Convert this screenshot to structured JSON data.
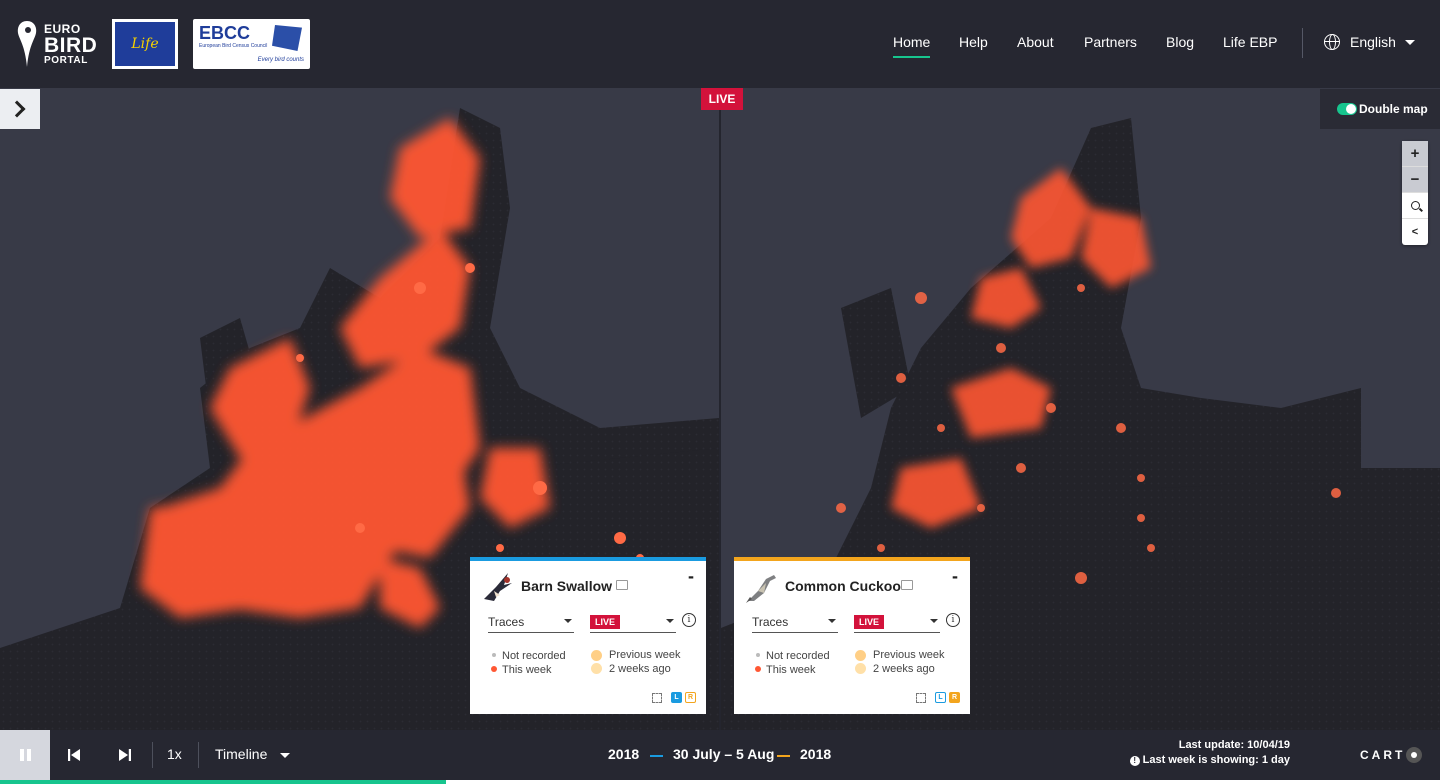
{
  "header": {
    "logo": {
      "line1": "EURO",
      "line2": "BIRD",
      "line3": "PORTAL"
    },
    "life_logo_text": "Life",
    "ebcc_logo": {
      "title": "EBCC",
      "subtitle": "European Bird Census Council",
      "tagline": "Every bird counts"
    },
    "nav": [
      {
        "label": "Home",
        "active": true
      },
      {
        "label": "Help",
        "active": false
      },
      {
        "label": "About",
        "active": false
      },
      {
        "label": "Partners",
        "active": false
      },
      {
        "label": "Blog",
        "active": false
      },
      {
        "label": "Life EBP",
        "active": false
      }
    ],
    "language": "English"
  },
  "map": {
    "live_badge": "LIVE",
    "double_map_label": "Double map",
    "double_map_on": true,
    "zoom_in": "+",
    "zoom_out": "−",
    "colors": {
      "heat": "#ff5733",
      "land": "#232329",
      "sea": "#383a47",
      "accent": "#17c58e",
      "live": "#d3123b"
    }
  },
  "cards": [
    {
      "species": "Barn Swallow",
      "accent": "#1a9be0",
      "view": "Traces",
      "mode": "LIVE",
      "legend": {
        "not_recorded": "Not recorded",
        "this_week": "This week",
        "previous_week": "Previous week",
        "two_weeks": "2 weeks ago"
      },
      "badge_l": "L",
      "badge_r": "R",
      "icon": "swallow-icon"
    },
    {
      "species": "Common Cuckoo",
      "accent": "#f3a51d",
      "view": "Traces",
      "mode": "LIVE",
      "legend": {
        "not_recorded": "Not recorded",
        "this_week": "This week",
        "previous_week": "Previous week",
        "two_weeks": "2 weeks ago"
      },
      "badge_l": "L",
      "badge_r": "R",
      "icon": "cuckoo-icon"
    }
  ],
  "bottom": {
    "speed": "1x",
    "timeline_label": "Timeline",
    "year_left": "2018",
    "date_range": "30 July – 5 Aug",
    "year_right": "2018",
    "last_update": "Last update: 10/04/19",
    "last_week_showing": "Last week is showing: 1 day",
    "carto": "CART",
    "progress": 0.31
  }
}
